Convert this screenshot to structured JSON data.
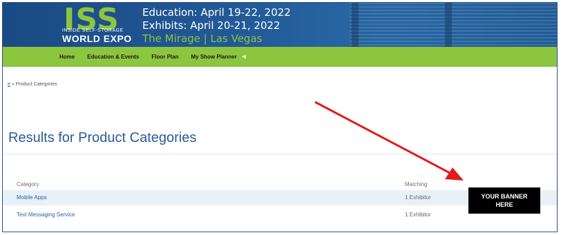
{
  "header": {
    "logo_word": "ISS",
    "logo_subtitle": "INSIDE SELF-STORAGE",
    "logo_expo": "WORLD EXPO",
    "education_line": "Education: April 19-22, 2022",
    "exhibits_line": "Exhibits: April 20-21, 2022",
    "venue_line": "The Mirage | Las Vegas"
  },
  "nav": {
    "items": [
      {
        "label": "Home"
      },
      {
        "label": "Education & Events"
      },
      {
        "label": "Floor Plan"
      },
      {
        "label": "My Show Planner"
      }
    ]
  },
  "breadcrumb": {
    "home": "e",
    "separator": "»",
    "current": "Product Categories"
  },
  "page": {
    "title": "Results for Product Categories"
  },
  "table": {
    "headers": {
      "category": "Category",
      "matching": "Matching"
    },
    "rows": [
      {
        "category": "Mobile Apps",
        "matching": "1 Exhibitor"
      },
      {
        "category": "Text Messaging Service",
        "matching": "1 Exhibitor"
      }
    ]
  },
  "banner": {
    "line1": "YOUR BANNER",
    "line2": "HERE"
  },
  "colors": {
    "nav_green": "#8cc63f",
    "header_blue": "#1b4a83",
    "title_blue": "#2b5b9a",
    "arrow_red": "#e21b1b",
    "highlight_row": "#e8f1f8"
  }
}
